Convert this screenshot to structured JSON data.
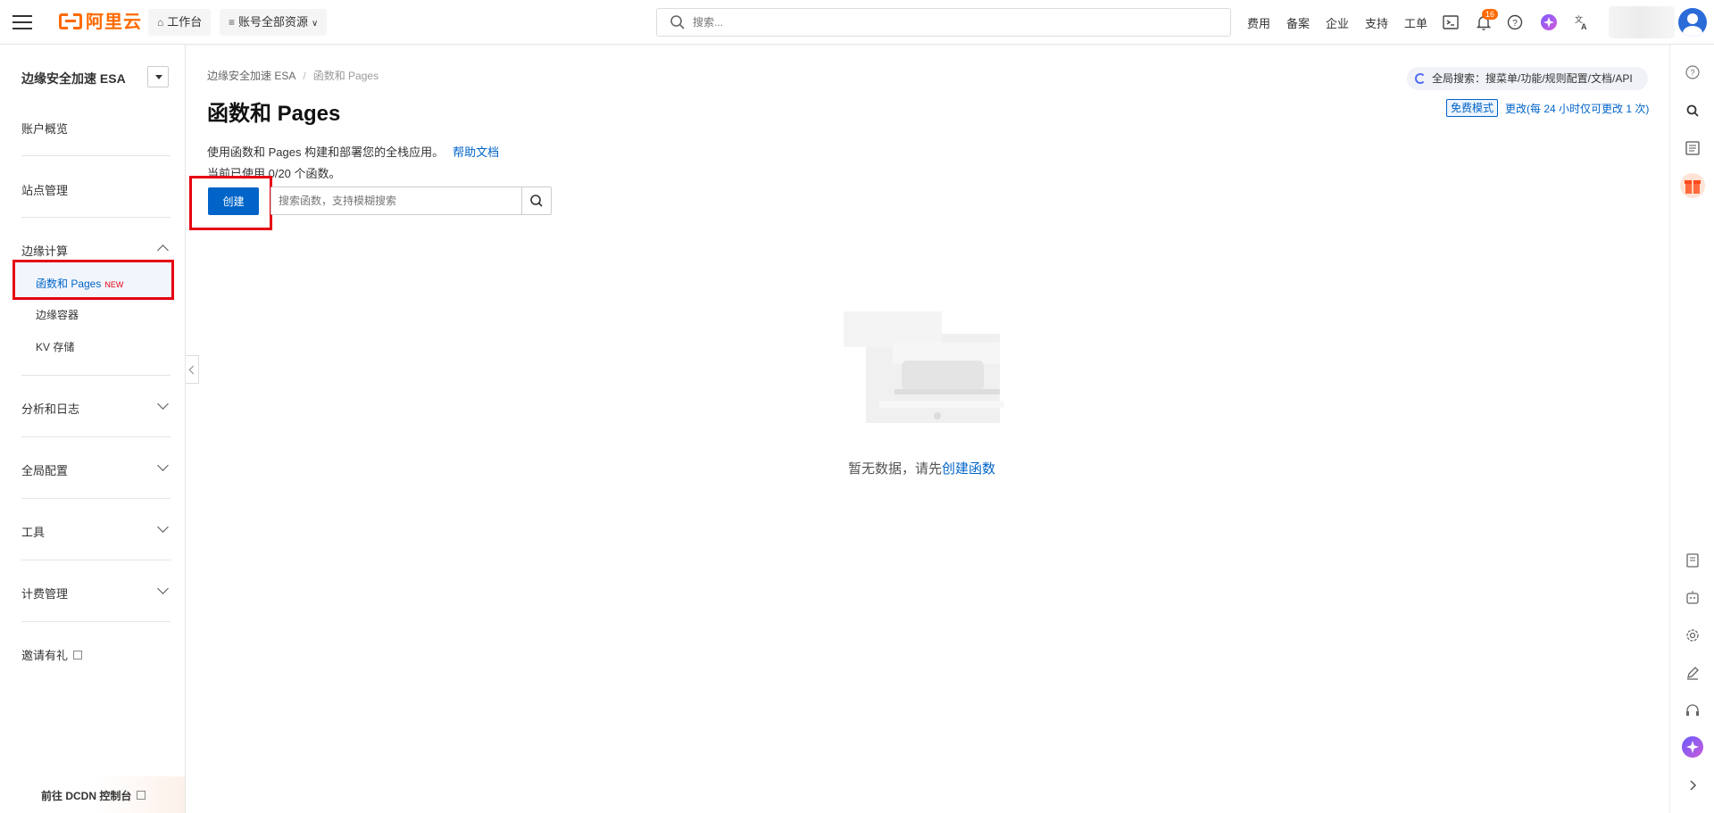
{
  "topbar": {
    "brand": "阿里云",
    "workbench": "工作台",
    "resource_group": "账号全部资源",
    "search_placeholder": "搜索...",
    "links": [
      "费用",
      "备案",
      "企业",
      "支持",
      "工单"
    ],
    "notification_count": "16"
  },
  "sidebar": {
    "product_title": "边缘安全加速 ESA",
    "overview": "账户概览",
    "site_mgmt": "站点管理",
    "edge_compute": "边缘计算",
    "functions_pages": "函数和 Pages",
    "new_tag": "NEW",
    "edge_container": "边缘容器",
    "kv_storage": "KV 存储",
    "analytics": "分析和日志",
    "global_config": "全局配置",
    "tools": "工具",
    "billing": "计费管理",
    "invite": "邀请有礼",
    "goto_dcdn": "前往 DCDN 控制台"
  },
  "main": {
    "breadcrumb": [
      "边缘安全加速 ESA",
      "函数和 Pages"
    ],
    "title": "函数和 Pages",
    "description": "使用函数和 Pages 构建和部署您的全栈应用。",
    "help_link": "帮助文档",
    "usage": "当前已使用 0/20 个函数。",
    "create_button": "创建",
    "search_placeholder": "搜索函数，支持模糊搜索",
    "global_search": "全局搜索：搜菜单/功能/规则配置/文档/API",
    "free_mode": "免费模式",
    "change_link": "更改(每 24 小时仅可更改 1 次)",
    "empty_text": "暂无数据，请先",
    "empty_link": "创建函数"
  },
  "colors": {
    "brand": "#ff6a00",
    "primary": "#0064c8",
    "highlight": "#e60012"
  }
}
